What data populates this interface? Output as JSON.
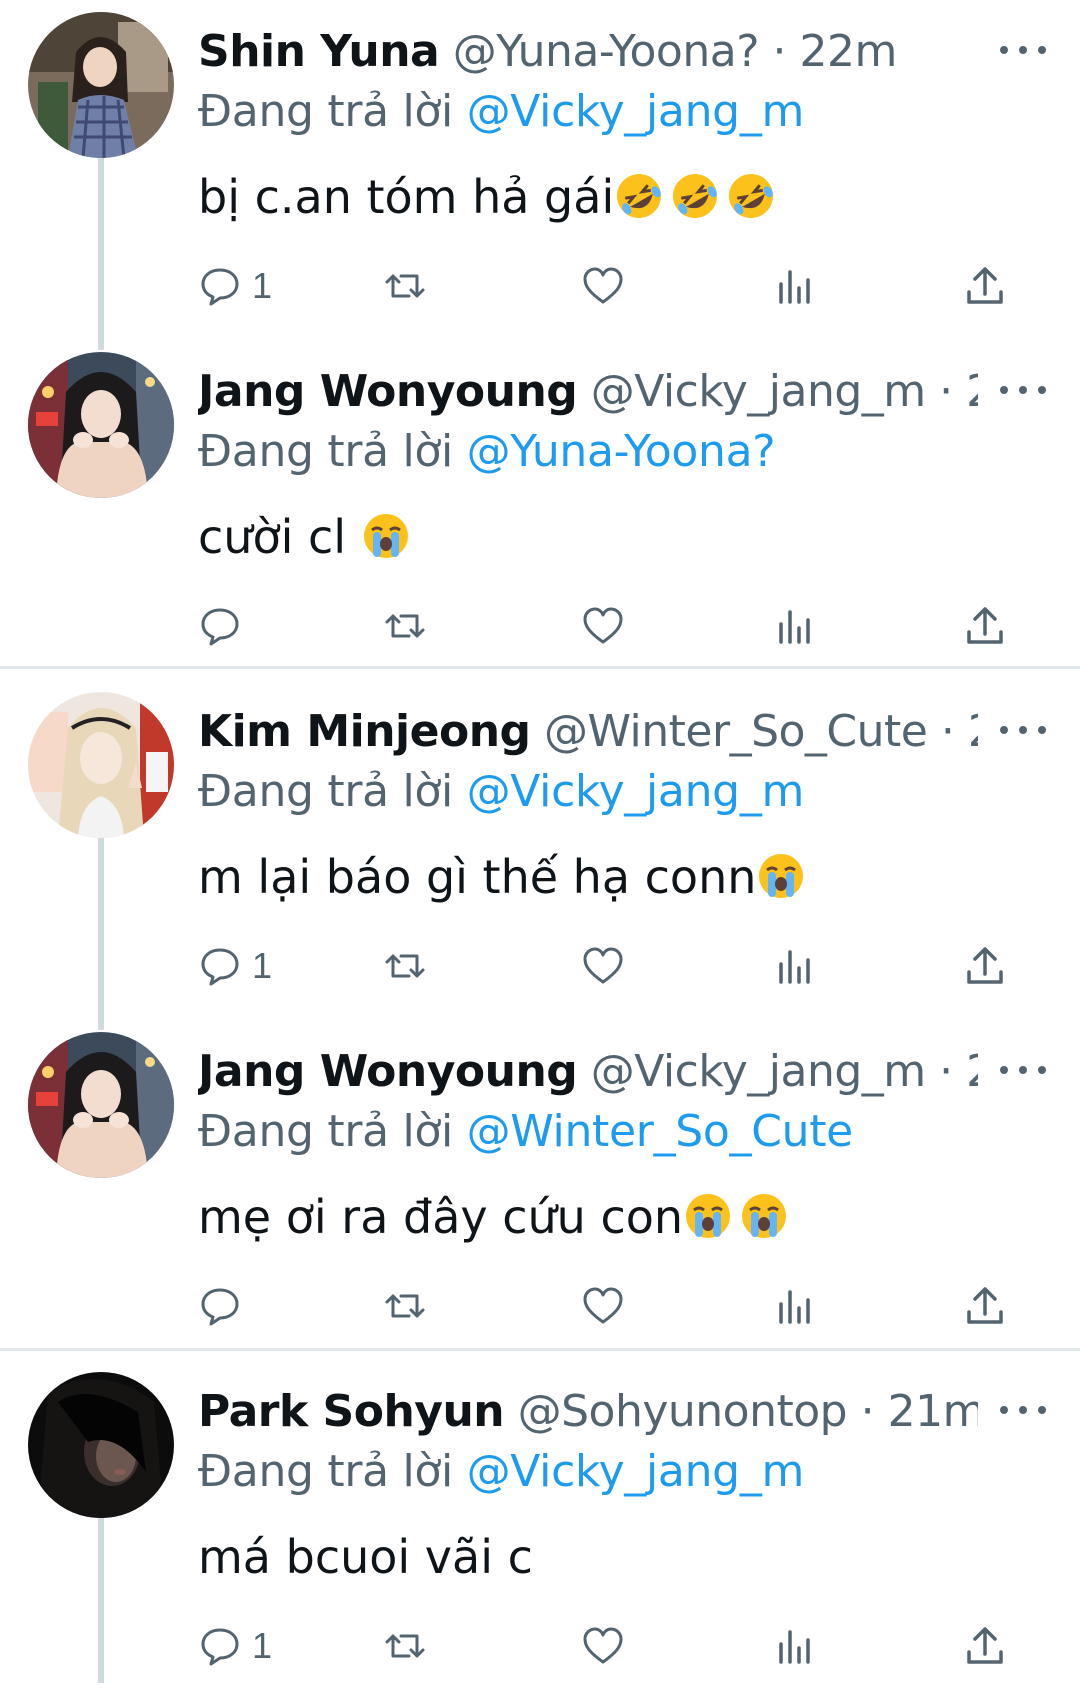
{
  "reply_prefix": "Đang trả lời",
  "colors": {
    "link": "#1d9bf0",
    "secondary_text": "#536471",
    "primary_text": "#0f1419",
    "thread_line": "#cfd9de"
  },
  "tweets": [
    {
      "display_name": "Shin Yuna",
      "handle": "@Yuna-Yoona?",
      "time": "22m",
      "reply_to": "@Vicky_jang_m",
      "text": "bị c.an tóm hả gái",
      "emojis": [
        "rolling-on-floor-laughing",
        "rolling-on-floor-laughing",
        "rolling-on-floor-laughing"
      ],
      "reply_count": "1"
    },
    {
      "display_name": "Jang Wonyoung",
      "handle": "@Vicky_jang_m",
      "time": "2...",
      "reply_to": "@Yuna-Yoona?",
      "text": "cười cl ",
      "emojis": [
        "loudly-crying-face"
      ],
      "reply_count": ""
    },
    {
      "display_name": "Kim Minjeong",
      "handle": "@Winter_So_Cute",
      "time": "2...",
      "reply_to": "@Vicky_jang_m",
      "text": "m lại báo gì thế hạ conn",
      "emojis": [
        "loudly-crying-face"
      ],
      "reply_count": "1"
    },
    {
      "display_name": "Jang Wonyoung",
      "handle": "@Vicky_jang_m",
      "time": "2...",
      "reply_to": "@Winter_So_Cute",
      "text": "mẹ ơi ra đây cứu con",
      "emojis": [
        "loudly-crying-face",
        "loudly-crying-face"
      ],
      "reply_count": ""
    },
    {
      "display_name": "Park Sohyun",
      "handle": "@Sohyunontop",
      "time": "21m",
      "reply_to": "@Vicky_jang_m",
      "text": "má bcuoi vãi c",
      "emojis": [],
      "reply_count": "1"
    }
  ]
}
